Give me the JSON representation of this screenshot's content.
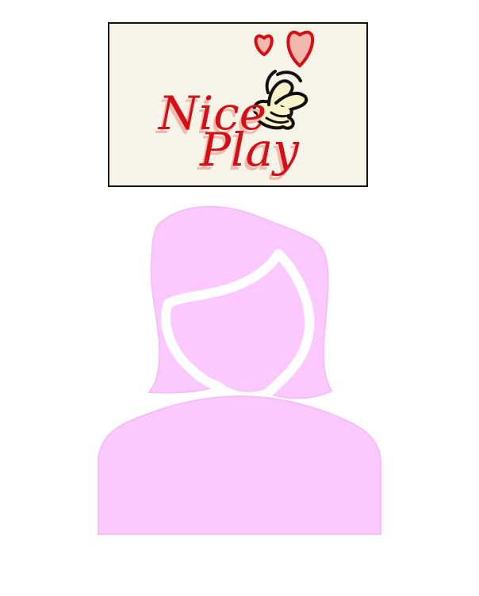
{
  "sticker": {
    "line1": "Nice",
    "line2": "Play",
    "icons": [
      "heart-icon",
      "finger-heart-hand-icon"
    ]
  },
  "avatar": {
    "icon": "female-user-avatar-icon"
  },
  "colors": {
    "background": "#ffffff",
    "sticker_background": "#f6f3e8",
    "sticker_border": "#111111",
    "sticker_text": "#d40f16",
    "sticker_glow": "#f2b7ad",
    "hand_fill": "#f7f2c9",
    "avatar_fill": "#fbc9ff",
    "avatar_edge": "#f3c0f6"
  }
}
